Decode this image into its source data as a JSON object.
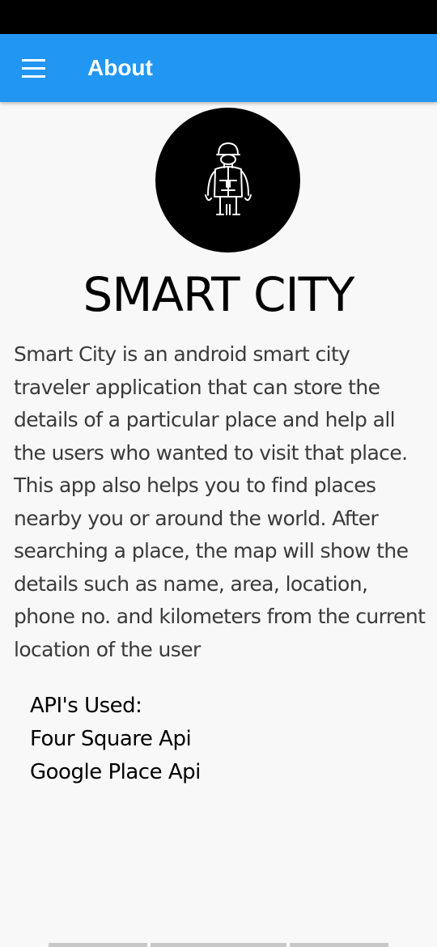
{
  "app_bar": {
    "title": "About",
    "menu_icon": "hamburger-menu-icon",
    "background_color": "#2196f3"
  },
  "logo": {
    "icon": "astronaut-traveler-icon"
  },
  "app_name": "SMART CITY",
  "description": "Smart City is an android smart city traveler application that can store the details of a particular place and help all the users who wanted to visit that place. This app also helps you to find places nearby you or around the world. After searching a place, the map will show the details such as name, area, location, phone no. and kilometers from the current location of the user",
  "apis": {
    "heading": "API's Used:",
    "items": [
      "Four Square Api",
      "Google Place Api"
    ]
  }
}
